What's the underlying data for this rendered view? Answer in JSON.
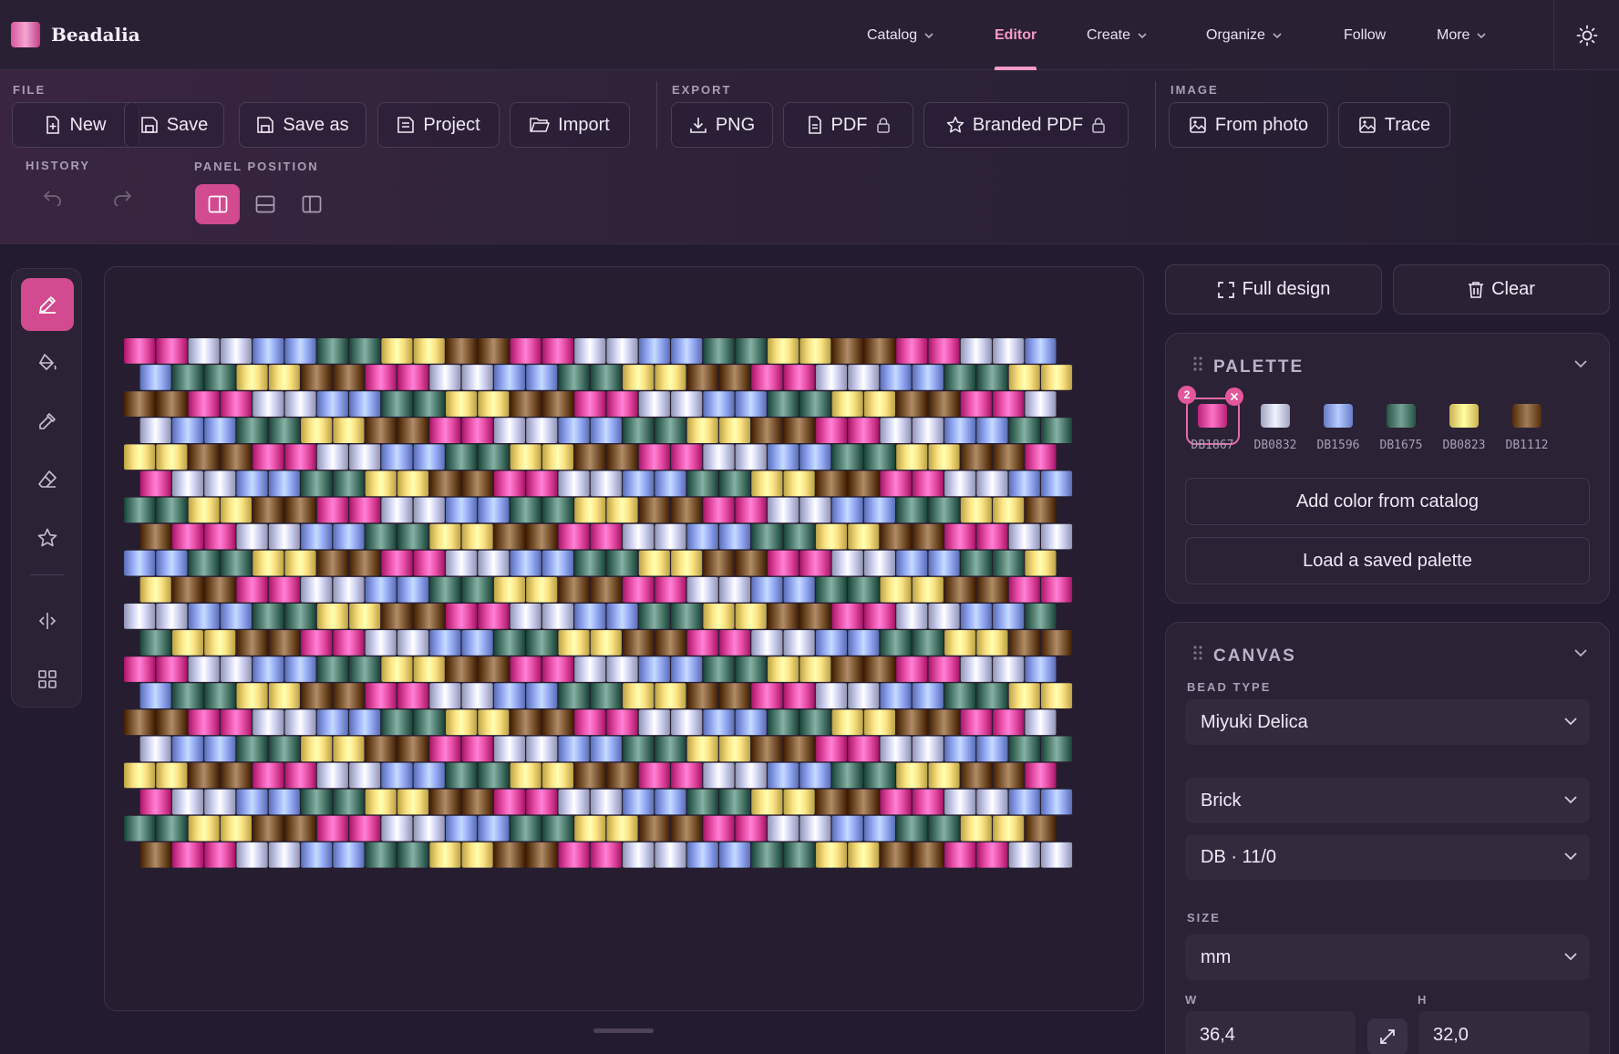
{
  "app": {
    "name": "Beadalia"
  },
  "nav": {
    "items": [
      {
        "label": "Catalog",
        "dropdown": true
      },
      {
        "label": "Editor",
        "dropdown": false,
        "active": true
      },
      {
        "label": "Create",
        "dropdown": true
      },
      {
        "label": "Organize",
        "dropdown": true
      },
      {
        "label": "Follow",
        "dropdown": false
      },
      {
        "label": "More",
        "dropdown": true
      }
    ],
    "theme_icon": "sun-icon"
  },
  "toolbar": {
    "file": {
      "label": "FILE",
      "buttons": [
        "New",
        "Save",
        "Save as",
        "Project",
        "Import"
      ]
    },
    "export": {
      "label": "EXPORT",
      "buttons": [
        {
          "label": "PNG",
          "locked": false
        },
        {
          "label": "PDF",
          "locked": true
        },
        {
          "label": "Branded PDF",
          "locked": true
        }
      ]
    },
    "image": {
      "label": "IMAGE",
      "buttons": [
        "From photo",
        "Trace"
      ]
    },
    "history": {
      "label": "HISTORY"
    },
    "panel_position": {
      "label": "PANEL POSITION",
      "selected": "right"
    }
  },
  "tools": [
    "pencil-icon",
    "paint-bucket-icon",
    "eyedropper-icon",
    "eraser-icon",
    "star-icon",
    "mirror-icon",
    "grid-icon"
  ],
  "actions": {
    "full_design": "Full design",
    "clear": "Clear"
  },
  "palette": {
    "title": "PALETTE",
    "selected_index": 0,
    "selected_badge": "2",
    "colors": [
      {
        "code": "DB1867",
        "hex": "#e04aa0"
      },
      {
        "code": "DB0832",
        "hex": "#c9cbea"
      },
      {
        "code": "DB1596",
        "hex": "#8fa4ec"
      },
      {
        "code": "DB1675",
        "hex": "#4f7a6e"
      },
      {
        "code": "DB0823",
        "hex": "#f2d97a"
      },
      {
        "code": "DB1112",
        "hex": "#7a5530"
      }
    ],
    "add_from_catalog": "Add color from catalog",
    "load_saved": "Load a saved palette"
  },
  "canvas_settings": {
    "title": "CANVAS",
    "bead_type_label": "BEAD TYPE",
    "bead_type": "Miyuki Delica",
    "stitch": "Brick",
    "bead_size": "DB · 11/0",
    "size_label": "SIZE",
    "unit": "mm",
    "width_label": "W",
    "width": "36,4",
    "height_label": "H",
    "height": "32,0"
  },
  "pattern": {
    "rows": 20,
    "columns": 28,
    "pattern_rule": "diagonal-stripes",
    "sequence": [
      0,
      0,
      1,
      1,
      2,
      2,
      3,
      3,
      4,
      4,
      5,
      5
    ]
  }
}
